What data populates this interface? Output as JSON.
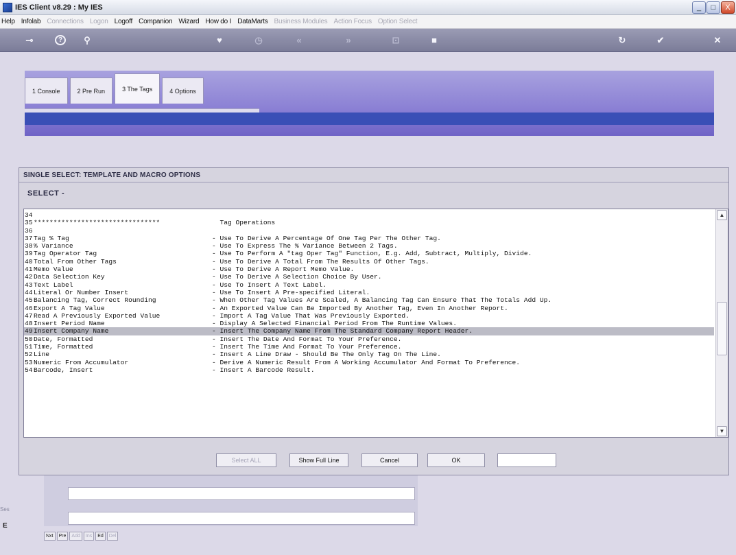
{
  "window": {
    "title": "IES Client v8.29 : My IES",
    "controls": [
      "_",
      "□",
      "X"
    ]
  },
  "menu": [
    {
      "label": "Help",
      "disabled": false
    },
    {
      "label": "Infolab",
      "disabled": false
    },
    {
      "label": "Connections",
      "disabled": true
    },
    {
      "label": "Logon",
      "disabled": true
    },
    {
      "label": "Logoff",
      "disabled": false
    },
    {
      "label": "Companion",
      "disabled": false
    },
    {
      "label": "Wizard",
      "disabled": false
    },
    {
      "label": "How do I",
      "disabled": false
    },
    {
      "label": "DataMarts",
      "disabled": false
    },
    {
      "label": "Business Modules",
      "disabled": true
    },
    {
      "label": "Action Focus",
      "disabled": true
    },
    {
      "label": "Option Select",
      "disabled": true
    }
  ],
  "toolbar_icons": [
    "key-icon",
    "help-icon",
    "search-icon",
    "heart-icon",
    "clock-icon",
    "back-icon",
    "forward-icon",
    "fit-icon",
    "stop-icon",
    "refresh-icon",
    "check-icon",
    "close-icon"
  ],
  "tabs": [
    "1 Console",
    "2 Pre Run",
    "3 The Tags",
    "4 Options"
  ],
  "dialog": {
    "title": "SINGLE SELECT: TEMPLATE AND MACRO OPTIONS",
    "select_label": "SELECT  -",
    "rows": [
      {
        "n": "34",
        "name": "",
        "desc": ""
      },
      {
        "n": "35",
        "name": "********************************",
        "desc": "  Tag Operations"
      },
      {
        "n": "36",
        "name": "",
        "desc": ""
      },
      {
        "n": "37",
        "name": "Tag % Tag",
        "desc": "- Use To Derive A Percentage Of One Tag Per The Other Tag."
      },
      {
        "n": "38",
        "name": "% Variance",
        "desc": "- Use To Express The % Variance Between 2 Tags."
      },
      {
        "n": "39",
        "name": "Tag Operator Tag",
        "desc": "- Use To Perform A \"tag Oper Tag\" Function, E.g. Add, Subtract, Multiply, Divide."
      },
      {
        "n": "40",
        "name": "Total From Other Tags",
        "desc": "- Use To Derive A Total From The Results Of Other Tags."
      },
      {
        "n": "41",
        "name": "Memo Value",
        "desc": "- Use To Derive A Report Memo Value."
      },
      {
        "n": "42",
        "name": "Data Selection Key",
        "desc": "- Use To Derive A Selection Choice By User."
      },
      {
        "n": "43",
        "name": "Text Label",
        "desc": "- Use To Insert A Text Label."
      },
      {
        "n": "44",
        "name": "Literal Or Number Insert",
        "desc": "- Use To Insert A Pre-specified Literal."
      },
      {
        "n": "45",
        "name": "Balancing Tag, Correct Rounding",
        "desc": "- When Other Tag Values Are Scaled, A Balancing Tag Can Ensure That The Totals Add Up."
      },
      {
        "n": "46",
        "name": "Export A Tag Value",
        "desc": "- An Exported Value Can Be Imported By Another Tag, Even In Another Report."
      },
      {
        "n": "47",
        "name": "Read A Previously Exported Value",
        "desc": "- Import A Tag Value That Was Previously Exported."
      },
      {
        "n": "48",
        "name": "Insert Period Name",
        "desc": "- Display A Selected Financial Period From The Runtime Values."
      },
      {
        "n": "49",
        "name": "Insert Company Name",
        "desc": "- Insert The Company Name From The Standard Company Report Header."
      },
      {
        "n": "50",
        "name": "Date, Formatted",
        "desc": "- Insert The Date And Format To Your Preference."
      },
      {
        "n": "51",
        "name": "Time, Formatted",
        "desc": "- Insert The Time And Format To Your Preference."
      },
      {
        "n": "52",
        "name": "Line",
        "desc": "- Insert A Line Draw - Should Be The Only Tag On The Line."
      },
      {
        "n": "53",
        "name": "Numeric From Accumulator",
        "desc": "- Derive A Numeric Result From A Working Accumulator And Format To Preference."
      },
      {
        "n": "54",
        "name": "Barcode, Insert",
        "desc": "- Insert A Barcode Result."
      }
    ],
    "selected_row": "49",
    "buttons": {
      "select_all": "Select ALL",
      "show_full_line": "Show Full Line",
      "cancel": "Cancel",
      "ok": "OK"
    }
  },
  "bottom": {
    "side_label": "Ses",
    "side_mark": "E",
    "nav": [
      {
        "label": "Nxt",
        "disabled": false
      },
      {
        "label": "Pre",
        "disabled": false
      },
      {
        "label": "Add",
        "disabled": true
      },
      {
        "label": "Ins",
        "disabled": true
      },
      {
        "label": "Ed",
        "disabled": false
      },
      {
        "label": "Del",
        "disabled": true
      }
    ]
  }
}
